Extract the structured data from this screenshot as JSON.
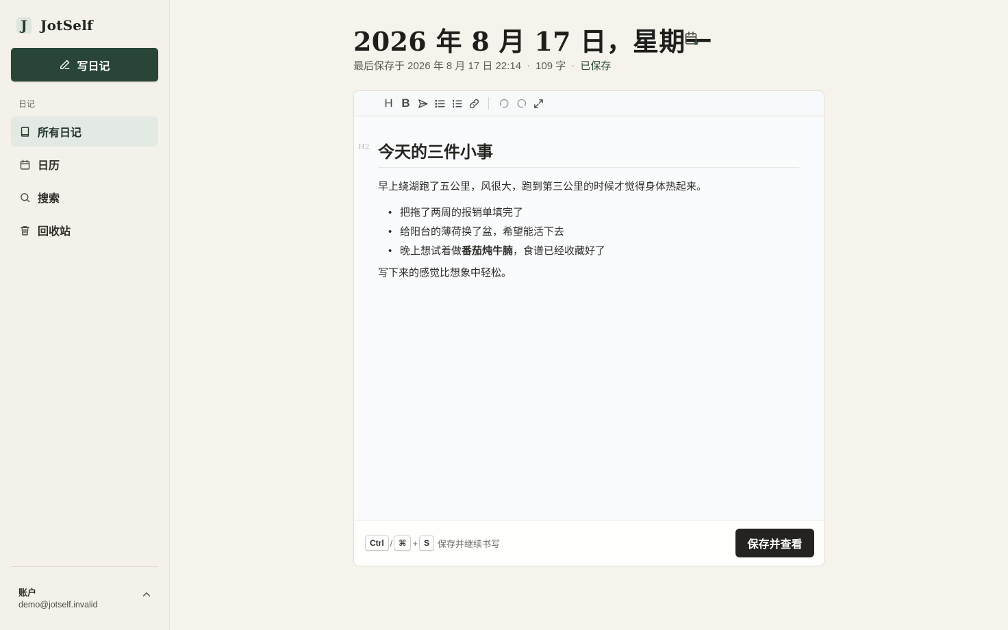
{
  "app": {
    "logo_letter": "J",
    "name": "JotSelf"
  },
  "sidebar": {
    "write_button": "写日记",
    "section_label": "日记",
    "items": [
      {
        "label": "所有日记",
        "icon": "book-icon",
        "active": true
      },
      {
        "label": "日历",
        "icon": "calendar-icon",
        "active": false
      },
      {
        "label": "搜索",
        "icon": "search-icon",
        "active": false
      },
      {
        "label": "回收站",
        "icon": "trash-icon",
        "active": false
      }
    ],
    "account": {
      "title": "账户",
      "email": "demo@jotself.invalid"
    }
  },
  "entry": {
    "title": "2026 年 8 月 17 日，星期一",
    "last_saved": "最后保存于 2026 年 8 月 17 日 22:14",
    "word_count": "109 字",
    "status": "已保存",
    "dot": "·"
  },
  "toolbar": {
    "heading": "H",
    "bold": "B"
  },
  "document": {
    "h2_marker": "H2",
    "heading": "今天的三件小事",
    "paragraph1": "早上绕湖跑了五公里，风很大，跑到第三公里的时候才觉得身体热起来。",
    "bullet1": "把拖了两周的报销单填完了",
    "bullet2": "给阳台的薄荷换了盆，希望能活下去",
    "bullet3_before": "晚上想试着做",
    "bullet3_bold": "番茄炖牛腩",
    "bullet3_after": "，食谱已经收藏好了",
    "paragraph2": "写下来的感觉比想象中轻松。"
  },
  "footer": {
    "key_ctrl": "Ctrl",
    "slash": "/",
    "key_cmd": "⌘",
    "plus": "+",
    "key_s": "S",
    "hint": "保存并继续书写",
    "save_button": "保存并查看"
  },
  "colors": {
    "accent": "#284538",
    "background": "#f6f3ec",
    "active_nav": "#e3eae3",
    "save_button": "#24231f"
  }
}
